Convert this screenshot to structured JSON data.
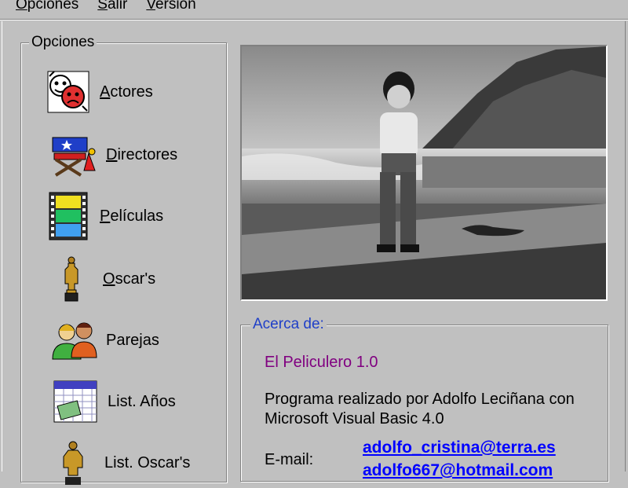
{
  "menu": {
    "items": [
      {
        "first": "O",
        "rest": "pciones"
      },
      {
        "first": "S",
        "rest": "alir"
      },
      {
        "first": "V",
        "rest": "ersión"
      }
    ]
  },
  "options": {
    "title": "Opciones",
    "items": [
      {
        "label_u": "A",
        "label_rest": "ctores",
        "icon": "actors-masks-icon"
      },
      {
        "label_u": "D",
        "label_rest": "irectores",
        "icon": "director-chair-icon"
      },
      {
        "label_u": "P",
        "label_rest": "elículas",
        "icon": "film-strip-icon"
      },
      {
        "label_u": "O",
        "label_rest": "scar's",
        "icon": "oscar-statuette-icon"
      },
      {
        "label_u": "",
        "label_rest": "Parejas",
        "icon": "couple-people-icon"
      },
      {
        "label_u": "",
        "label_rest": "List. Años",
        "icon": "calendar-list-icon"
      },
      {
        "label_u": "",
        "label_rest": "List. Oscar's",
        "icon": "oscar-list-icon"
      }
    ]
  },
  "about": {
    "title": "Acerca de:",
    "app_name": "El Peliculero 1.0",
    "description": "Programa realizado por Adolfo Leciñana con Microsoft Visual Basic 4.0",
    "email_label": "E-mail:",
    "emails": [
      "adolfo_cristina@terra.es",
      "adolfo667@hotmail.com"
    ]
  },
  "colors": {
    "window_bg": "#c0c0c0",
    "about_legend": "#1f3fc8",
    "app_name": "#800080",
    "link": "#0000ff"
  }
}
